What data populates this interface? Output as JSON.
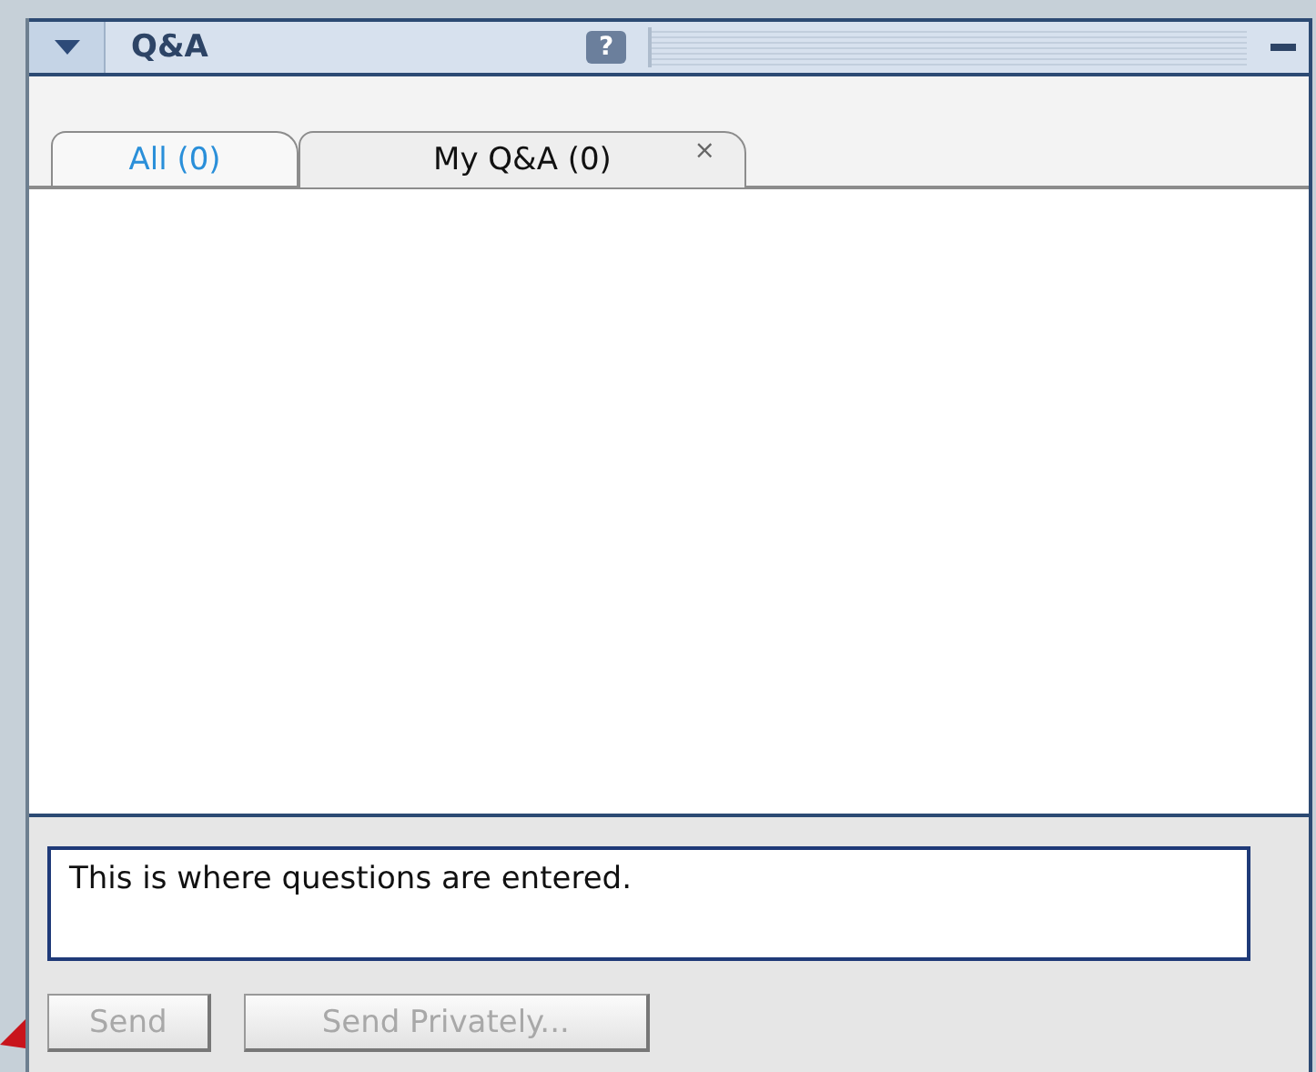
{
  "panel": {
    "title": "Q&A",
    "help_icon": "?"
  },
  "tabs": [
    {
      "label": "All (0)",
      "selected": true
    },
    {
      "label": "My Q&A (0)",
      "selected": false,
      "close_icon": "×"
    }
  ],
  "question_field": {
    "value": "This is where questions are entered."
  },
  "buttons": [
    {
      "label": "Send",
      "disabled": true
    },
    {
      "label": "Send Privately...",
      "disabled": true
    }
  ]
}
